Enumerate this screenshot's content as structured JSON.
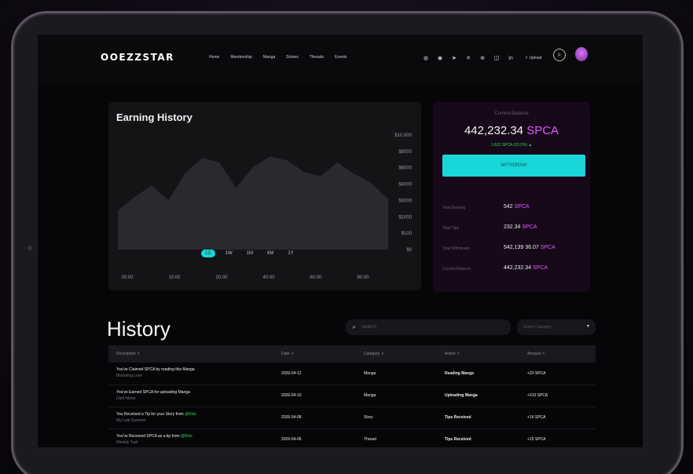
{
  "header": {
    "logo": "OOEZZSTAR",
    "nav": [
      "Home",
      "Membership",
      "Manga",
      "Stories",
      "Threads",
      "Events"
    ],
    "upload_label": "Upload"
  },
  "earning": {
    "title": "Earning History",
    "range_tabs": [
      "1D",
      "1W",
      "1M",
      "6M",
      "1Y"
    ],
    "active_range": "1D"
  },
  "chart_data": {
    "type": "area",
    "title": "Earning History",
    "x": [
      "00:00",
      "10:00",
      "20:00",
      "40:00",
      "60:00",
      "80:00"
    ],
    "y_ticks": [
      "$0",
      "$100",
      "$1000",
      "$3000",
      "$4000",
      "$6000",
      "$8000",
      "$10,000"
    ],
    "values": [
      3400,
      4600,
      5600,
      4300,
      6700,
      8000,
      7600,
      5400,
      7200,
      8100,
      7800,
      6800,
      6400,
      7600,
      6600,
      5800,
      4400
    ],
    "color": "#2a2a2e"
  },
  "balance": {
    "label": "Current Balance",
    "amount": "442,232.34",
    "unit": "SPCA",
    "change": "1,822 SPCA (33.2%)",
    "withdraw_label": "WITHDRAW",
    "stats": [
      {
        "label": "Total Earning",
        "value": "542",
        "unit": "SPCA"
      },
      {
        "label": "Total Tips",
        "value": "232.34",
        "unit": "SPCA"
      },
      {
        "label": "Total Withdrawn",
        "value": "542,139 36.07",
        "unit": "SPCA"
      },
      {
        "label": "Current Balance",
        "value": "442,232.34",
        "unit": "SPCA"
      }
    ]
  },
  "history": {
    "title": "History",
    "search_placeholder": "Search",
    "category_placeholder": "Select Category",
    "columns": [
      "Description",
      "Date",
      "Category",
      "Action",
      "Amount"
    ],
    "rows": [
      {
        "desc": "You've Claimed SPCA by reading this Manga",
        "desc_highlight": "",
        "sub": "Blooming Love",
        "date": "2026-04-12",
        "category": "Manga",
        "action": "Reading Manga",
        "amount": "+20 SPCA"
      },
      {
        "desc": "You've Earned SPCA for uploading Manga",
        "desc_highlight": "",
        "sub": "Dark Moon",
        "date": "2026-04-10",
        "category": "Manga",
        "action": "Uploading Manga",
        "amount": "+310 SPCA"
      },
      {
        "desc": "You Received a Tip for your Story from ",
        "desc_highlight": "@Rick",
        "sub": "My Lost Summer",
        "date": "2026-04-08",
        "category": "Story",
        "action": "Tips Received",
        "amount": "+16 SPCA"
      },
      {
        "desc": "You've Received SPCA as a tip from ",
        "desc_highlight": "@Rick",
        "sub": "Weekly Trail",
        "date": "2026-04-06",
        "category": "Thread",
        "action": "Tips Received",
        "amount": "+15 SPCA"
      }
    ]
  }
}
